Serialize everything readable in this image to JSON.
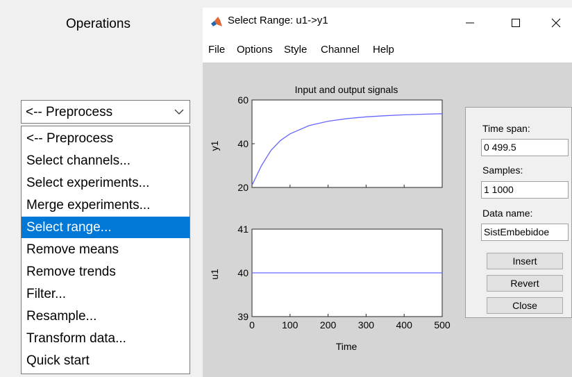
{
  "operations": {
    "title": "Operations",
    "combo_value": "<-- Preprocess",
    "items": [
      "<-- Preprocess",
      "Select channels...",
      "Select experiments...",
      "Merge experiments...",
      "Select range...",
      "Remove means",
      "Remove trends",
      "Filter...",
      "Resample...",
      "Transform data...",
      "Quick start"
    ],
    "selected_index": 4
  },
  "window": {
    "title": "Select Range: u1->y1",
    "menu": [
      "File",
      "Options",
      "Style",
      "Channel",
      "Help"
    ]
  },
  "plot": {
    "title": "Input and output signals",
    "xlabel": "Time",
    "top_ylabel": "y1",
    "bottom_ylabel": "u1",
    "x_ticks": [
      "0",
      "100",
      "200",
      "300",
      "400",
      "500"
    ],
    "top_y_ticks": [
      "60",
      "40",
      "20"
    ],
    "bottom_y_ticks": [
      "41",
      "40",
      "39"
    ],
    "line_color": "#6666ff"
  },
  "chart_data": [
    {
      "type": "line",
      "title": "Input and output signals",
      "ylabel": "y1",
      "xlim": [
        0,
        500
      ],
      "ylim": [
        20,
        60
      ],
      "x": [
        0,
        25,
        50,
        75,
        100,
        150,
        200,
        250,
        300,
        350,
        400,
        450,
        500
      ],
      "series": [
        {
          "values": [
            21,
            30,
            37,
            41.5,
            44.5,
            48.3,
            50.3,
            51.5,
            52.3,
            52.8,
            53.2,
            53.5,
            53.7
          ]
        }
      ]
    },
    {
      "type": "line",
      "xlabel": "Time",
      "ylabel": "u1",
      "xlim": [
        0,
        500
      ],
      "ylim": [
        39,
        41
      ],
      "x": [
        0,
        500
      ],
      "series": [
        {
          "values": [
            40,
            40
          ]
        }
      ]
    }
  ],
  "side_panel": {
    "time_span_label": "Time span:",
    "time_span_value": "0 499.5",
    "samples_label": "Samples:",
    "samples_value": "1 1000",
    "data_name_label": "Data name:",
    "data_name_value": "SistEmbebidoe",
    "insert_label": "Insert",
    "revert_label": "Revert",
    "close_label": "Close"
  }
}
